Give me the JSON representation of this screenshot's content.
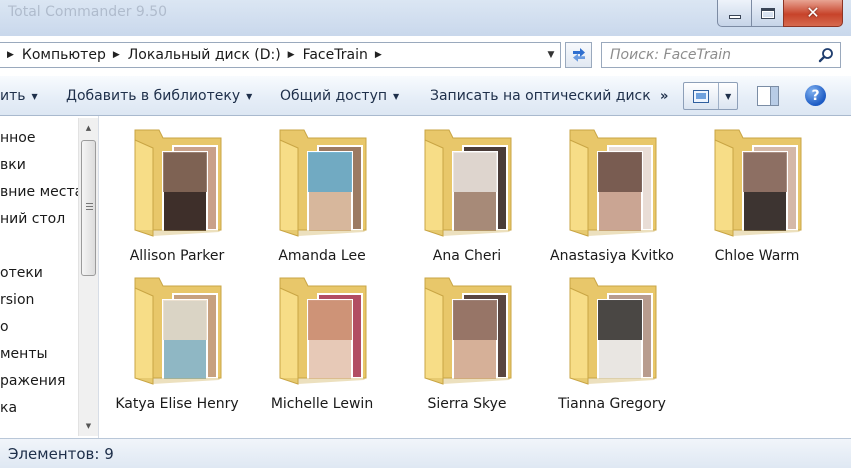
{
  "window": {
    "title": "Total Commander 9.50",
    "close_glyph": "✕"
  },
  "address": {
    "crumbs": [
      "Компьютер",
      "Локальный диск (D:)",
      "FaceTrain"
    ],
    "separator_glyph": "▶",
    "dropdown_glyph": "▼"
  },
  "search": {
    "placeholder": "Поиск: FaceTrain"
  },
  "toolbar": {
    "organize_partial": "ить",
    "add_to_library": "Добавить в библиотеку",
    "share": "Общий доступ",
    "burn": "Записать на оптический диск",
    "more_glyph": "»",
    "caret_glyph": "▼",
    "help_glyph": "?"
  },
  "navigation": {
    "items": [
      "нное",
      "вки",
      "вние места",
      "ний стол",
      "отеки",
      "rsion",
      "о",
      "менты",
      "ражения",
      "ка"
    ],
    "scroll_up_glyph": "▲",
    "scroll_down_glyph": "▼"
  },
  "folders": [
    {
      "name": "Allison Parker",
      "photo_tones": [
        "#8a6b5a",
        "#3e2f2a",
        "#c9a18a"
      ]
    },
    {
      "name": "Amanda Lee",
      "photo_tones": [
        "#5fa8c9",
        "#d7b79c",
        "#9c7a62"
      ]
    },
    {
      "name": "Ana Cheri",
      "photo_tones": [
        "#e7e2dd",
        "#a78a78",
        "#4a3c38"
      ]
    },
    {
      "name": "Anastasiya Kvitko",
      "photo_tones": [
        "#6b4f45",
        "#caa593",
        "#e9ddd6"
      ]
    },
    {
      "name": "Chloe Warm",
      "photo_tones": [
        "#9b7a6c",
        "#3d3431",
        "#d4b8a8"
      ]
    },
    {
      "name": "Katya Elise Henry",
      "photo_tones": [
        "#e8d9c6",
        "#8fb7c4",
        "#c7a17f"
      ]
    },
    {
      "name": "Michelle Lewin",
      "photo_tones": [
        "#c98a6c",
        "#e7c9b7",
        "#b24d63"
      ]
    },
    {
      "name": "Sierra Skye",
      "photo_tones": [
        "#8c6b5e",
        "#d6b098",
        "#5a4640"
      ]
    },
    {
      "name": "Tianna Gregory",
      "photo_tones": [
        "#2e2a28",
        "#e9e6e2",
        "#b89c8e"
      ]
    }
  ],
  "status": {
    "item_count": "Элементов: 9"
  },
  "colors": {
    "folder_back": "#e8c76a",
    "folder_front": "#f7dd87",
    "folder_edge": "#c9a544",
    "accent": "#1d5bc4"
  }
}
